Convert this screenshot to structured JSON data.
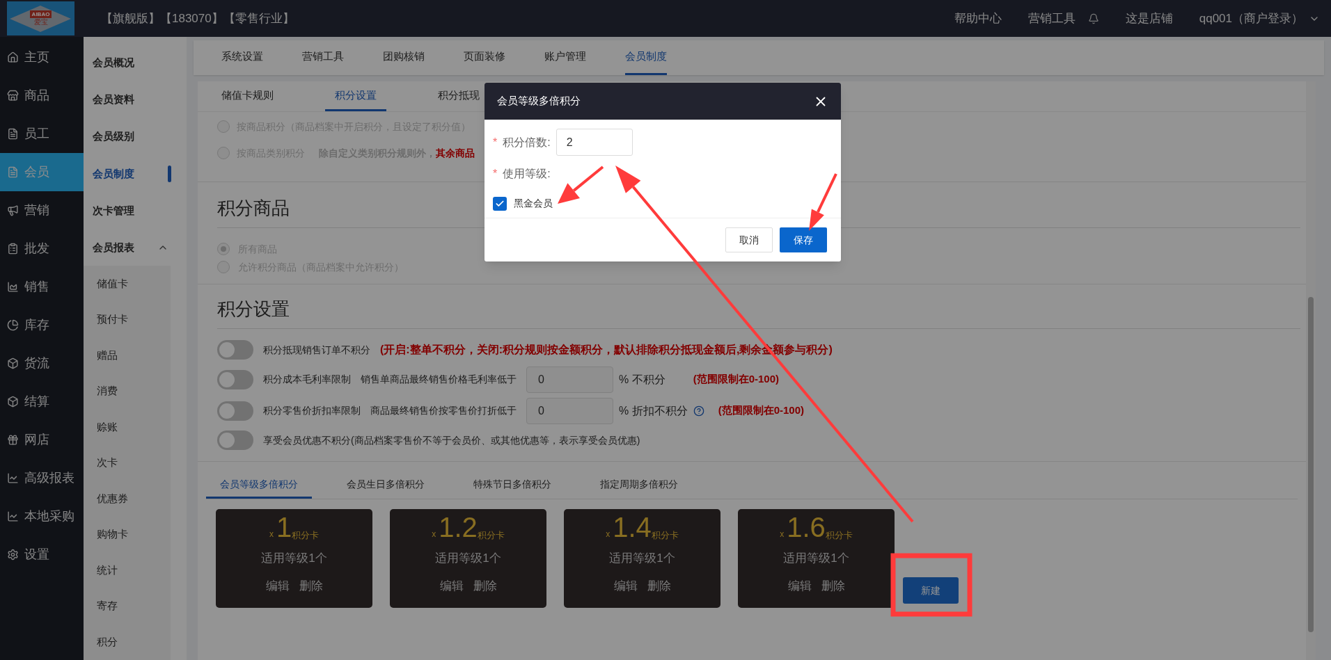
{
  "top_bar": {
    "logo": {
      "top": "AIBAO",
      "bottom": "爱宝"
    },
    "edition": "【旗舰版】【183070】【零售行业】",
    "links": [
      "帮助中心",
      "营销工具"
    ],
    "shop": "这是店铺",
    "user": "qq001（商户登录）"
  },
  "main_nav": [
    {
      "label": "主页",
      "selected": false
    },
    {
      "label": "商品",
      "selected": false
    },
    {
      "label": "员工",
      "selected": false
    },
    {
      "label": "会员",
      "selected": true
    },
    {
      "label": "营销",
      "selected": false
    },
    {
      "label": "批发",
      "selected": false
    },
    {
      "label": "销售",
      "selected": false
    },
    {
      "label": "库存",
      "selected": false
    },
    {
      "label": "货流",
      "selected": false
    },
    {
      "label": "结算",
      "selected": false
    },
    {
      "label": "网店",
      "selected": false
    },
    {
      "label": "高级报表",
      "selected": false
    },
    {
      "label": "本地采购",
      "selected": false
    },
    {
      "label": "设置",
      "selected": false
    }
  ],
  "sub_nav": [
    {
      "label": "会员概况",
      "selected": false
    },
    {
      "label": "会员资料",
      "selected": false
    },
    {
      "label": "会员级别",
      "selected": false
    },
    {
      "label": "会员制度",
      "selected": true
    },
    {
      "label": "次卡管理",
      "selected": false
    },
    {
      "label": "会员报表",
      "selected": false,
      "expanded": true,
      "children": [
        {
          "label": "储值卡",
          "selected": false
        },
        {
          "label": "预付卡",
          "selected": false
        },
        {
          "label": "赠品",
          "selected": false
        },
        {
          "label": "消费",
          "selected": false
        },
        {
          "label": "赊账",
          "selected": false
        },
        {
          "label": "次卡",
          "selected": false
        },
        {
          "label": "优惠券",
          "selected": false
        },
        {
          "label": "购物卡",
          "selected": false
        },
        {
          "label": "统计",
          "selected": false
        },
        {
          "label": "寄存",
          "selected": false
        },
        {
          "label": "积分",
          "selected": false
        }
      ]
    }
  ],
  "top_tabs": [
    {
      "label": "系统设置",
      "selected": false
    },
    {
      "label": "营销工具",
      "selected": false
    },
    {
      "label": "团购核销",
      "selected": false
    },
    {
      "label": "页面装修",
      "selected": false
    },
    {
      "label": "账户管理",
      "selected": false
    },
    {
      "label": "会员制度",
      "selected": true
    }
  ],
  "section_tabs": [
    {
      "label": "储值卡规则",
      "selected": false
    },
    {
      "label": "积分设置",
      "selected": true
    },
    {
      "label": "积分抵现",
      "selected": false
    }
  ],
  "points_rule_options": [
    {
      "label": "按商品积分（商品档案中开启积分，且设定了积分值）",
      "selected": false
    },
    {
      "label": "按商品类别积分",
      "note": "除自定义类别积分规则外，",
      "warning": "其余商品",
      "selected": false
    }
  ],
  "points_goods": {
    "title": "积分商品",
    "options": [
      {
        "label": "所有商品",
        "selected": true
      },
      {
        "label": "允许积分商品（商品档案中允许积分）",
        "selected": false
      }
    ]
  },
  "points_settings": {
    "title": "积分设置",
    "rows": [
      {
        "kind": "note",
        "on": false,
        "label": "积分抵现销售订单不积分",
        "note": "(开启:整单不积分，关闭:积分规则按金额积分，默认排除积分抵现金额后,剩余金额参与积分)"
      },
      {
        "kind": "input",
        "on": false,
        "label": "积分成本毛利率限制",
        "prefix": "销售单商品最终销售价格毛利率低于",
        "value": "0",
        "suffix": "% 不积分",
        "note": "(范围限制在0-100)"
      },
      {
        "kind": "input_help",
        "on": false,
        "label": "积分零售价折扣率限制",
        "prefix": "商品最终销售价按零售价打折低于",
        "value": "0",
        "suffix": "% 折扣不积分",
        "note": "(范围限制在0-100)"
      },
      {
        "kind": "plain",
        "on": false,
        "label": "享受会员优惠不积分(商品档案零售价不等于会员价、或其他优惠等，表示享受会员优惠)"
      }
    ]
  },
  "multiplier_tabs": [
    {
      "label": "会员等级多倍积分",
      "selected": true
    },
    {
      "label": "会员生日多倍积分",
      "selected": false
    },
    {
      "label": "特殊节日多倍积分",
      "selected": false
    },
    {
      "label": "指定周期多倍积分",
      "selected": false
    }
  ],
  "multiplier_cards": [
    {
      "prefix": "x",
      "value": "1",
      "unit": "积分卡",
      "levels": "适用等级1个",
      "actions": [
        "编辑",
        "删除"
      ]
    },
    {
      "prefix": "x",
      "value": "1.2",
      "unit": "积分卡",
      "levels": "适用等级1个",
      "actions": [
        "编辑",
        "删除"
      ]
    },
    {
      "prefix": "x",
      "value": "1.4",
      "unit": "积分卡",
      "levels": "适用等级1个",
      "actions": [
        "编辑",
        "删除"
      ]
    },
    {
      "prefix": "x",
      "value": "1.6",
      "unit": "积分卡",
      "levels": "适用等级1个",
      "actions": [
        "编辑",
        "删除"
      ]
    }
  ],
  "new_button": "新建",
  "dialog": {
    "title": "会员等级多倍积分",
    "multiplier": {
      "required_mark": "*",
      "label": "积分倍数:",
      "value": "2"
    },
    "level": {
      "required_mark": "*",
      "label": "使用等级:"
    },
    "levels": [
      {
        "label": "黑金会员",
        "checked": true
      }
    ],
    "buttons": [
      {
        "label": "取消",
        "kind": "default"
      },
      {
        "label": "保存",
        "kind": "primary"
      }
    ]
  }
}
